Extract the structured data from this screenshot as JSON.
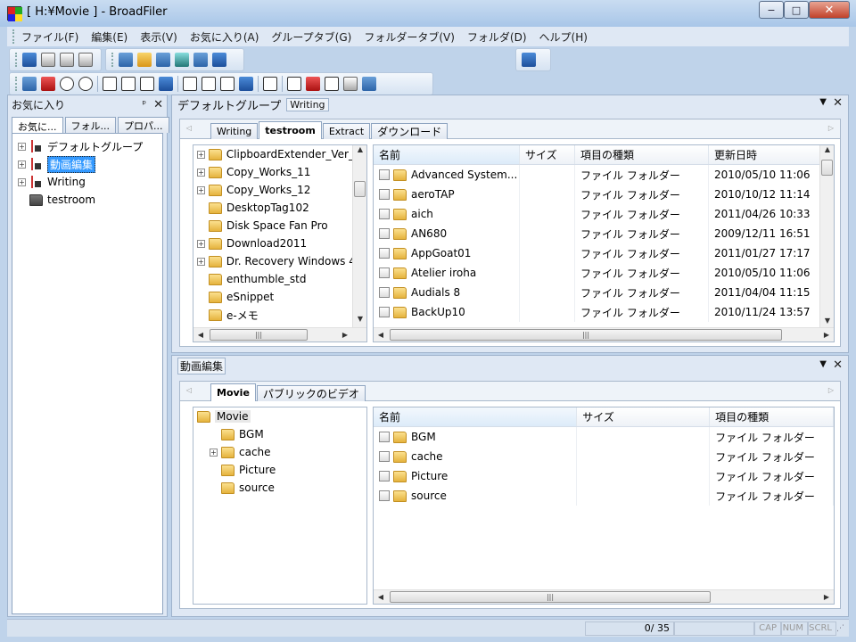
{
  "window": {
    "title": "[ H:¥Movie ] - BroadFiler",
    "min": "−",
    "max": "□",
    "close": "✕"
  },
  "menu": [
    "ファイル(F)",
    "編集(E)",
    "表示(V)",
    "お気に入り(A)",
    "グループタブ(G)",
    "フォルダータブ(V)",
    "フォルダ(D)",
    "ヘルプ(H)"
  ],
  "left": {
    "title": "お気に入り",
    "pin": "ᵖ",
    "close": "✕",
    "tabs": [
      "お気に...",
      "フォル...",
      "プロパ..."
    ],
    "tree": [
      {
        "label": "デフォルトグループ",
        "expander": "+",
        "icon": "group"
      },
      {
        "label": "動画編集",
        "expander": "+",
        "icon": "group",
        "selected": true
      },
      {
        "label": "Writing",
        "expander": "+",
        "icon": "group"
      },
      {
        "label": "testroom",
        "expander": "",
        "icon": "gray-folder"
      }
    ]
  },
  "top": {
    "group": "デフォルトグループ",
    "badge": "Writing",
    "tabs": [
      "Writing",
      "testroom",
      "Extract",
      "ダウンロード"
    ],
    "active_tab": "testroom",
    "tree": [
      {
        "label": "ClipboardExtender_Ver_",
        "exp": "+"
      },
      {
        "label": "Copy_Works_11",
        "exp": "+"
      },
      {
        "label": "Copy_Works_12",
        "exp": "+"
      },
      {
        "label": "DesktopTag102",
        "exp": ""
      },
      {
        "label": "Disk Space Fan Pro",
        "exp": ""
      },
      {
        "label": "Download2011",
        "exp": "+"
      },
      {
        "label": "Dr. Recovery Windows 4",
        "exp": "+"
      },
      {
        "label": "enthumble_std",
        "exp": ""
      },
      {
        "label": "eSnippet",
        "exp": ""
      },
      {
        "label": "e-メモ",
        "exp": ""
      }
    ],
    "columns": [
      "名前",
      "サイズ",
      "項目の種類",
      "更新日時"
    ],
    "rows": [
      {
        "name": "Advanced System...",
        "size": "",
        "type": "ファイル フォルダー",
        "date": "2010/05/10 11:06"
      },
      {
        "name": "aeroTAP",
        "size": "",
        "type": "ファイル フォルダー",
        "date": "2010/10/12 11:14"
      },
      {
        "name": "aich",
        "size": "",
        "type": "ファイル フォルダー",
        "date": "2011/04/26 10:33"
      },
      {
        "name": "AN680",
        "size": "",
        "type": "ファイル フォルダー",
        "date": "2009/12/11 16:51"
      },
      {
        "name": "AppGoat01",
        "size": "",
        "type": "ファイル フォルダー",
        "date": "2011/01/27 17:17"
      },
      {
        "name": "Atelier iroha",
        "size": "",
        "type": "ファイル フォルダー",
        "date": "2010/05/10 11:06"
      },
      {
        "name": "Audials 8",
        "size": "",
        "type": "ファイル フォルダー",
        "date": "2011/04/04 11:15"
      },
      {
        "name": "BackUp10",
        "size": "",
        "type": "ファイル フォルダー",
        "date": "2010/11/24 13:57"
      }
    ]
  },
  "bottom": {
    "group": "動画編集",
    "tabs": [
      "Movie",
      "パブリックのビデオ"
    ],
    "active_tab": "Movie",
    "tree": [
      {
        "label": "Movie",
        "exp": "",
        "root": true
      },
      {
        "label": "BGM",
        "exp": ""
      },
      {
        "label": "cache",
        "exp": "+"
      },
      {
        "label": "Picture",
        "exp": ""
      },
      {
        "label": "source",
        "exp": ""
      }
    ],
    "columns": [
      "名前",
      "サイズ",
      "項目の種類"
    ],
    "rows": [
      {
        "name": "BGM",
        "size": "",
        "type": "ファイル フォルダー"
      },
      {
        "name": "cache",
        "size": "",
        "type": "ファイル フォルダー"
      },
      {
        "name": "Picture",
        "size": "",
        "type": "ファイル フォルダー"
      },
      {
        "name": "source",
        "size": "",
        "type": "ファイル フォルダー"
      }
    ]
  },
  "status": {
    "count": "0/ 35",
    "caps": "CAP",
    "num": "NUM",
    "scrl": "SCRL"
  }
}
